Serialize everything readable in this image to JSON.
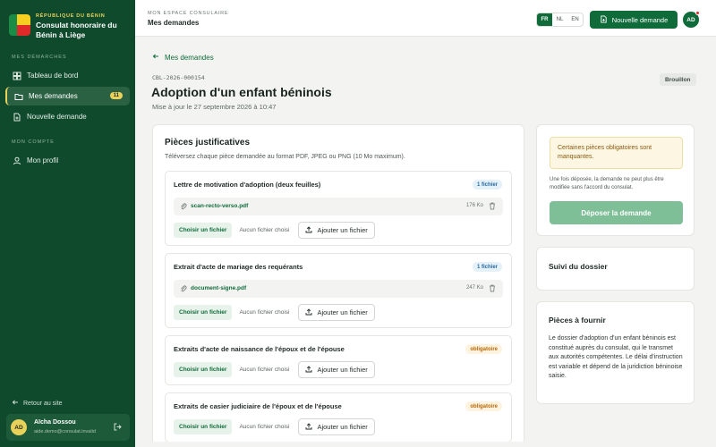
{
  "sidebar": {
    "kicker": "RÉPUBLIQUE DU BÉNIN",
    "org_name": "Consulat honoraire du Bénin à Liège",
    "section_demarches": "MES DÉMARCHES",
    "section_compte": "MON COMPTE",
    "items": [
      {
        "label": "Tableau de bord",
        "icon": "dashboard-icon"
      },
      {
        "label": "Mes demandes",
        "icon": "folder-icon",
        "badge": "11",
        "active": true
      },
      {
        "label": "Nouvelle demande",
        "icon": "file-plus-icon"
      },
      {
        "label": "Mon profil",
        "icon": "user-icon"
      }
    ],
    "back_label": "Retour au site",
    "user": {
      "initials": "AD",
      "name": "Aïcha Dossou",
      "email": "aide.demo@consulat.invalid"
    }
  },
  "header": {
    "kicker": "MON ESPACE CONSULAIRE",
    "title": "Mes demandes",
    "languages": [
      "FR",
      "NL",
      "EN"
    ],
    "active_language": "FR",
    "new_request_label": "Nouvelle demande",
    "avatar_initials": "AD"
  },
  "main": {
    "back_link": "Mes demandes",
    "reference": "CBL-2026-000154",
    "status": "Brouillon",
    "title": "Adoption d'un enfant béninois",
    "updated": "Mise à jour le 27 septembre 2026 à 10:47"
  },
  "pieces": {
    "title": "Pièces justificatives",
    "subtitle": "Téléversez chaque pièce demandée au format PDF, JPEG ou PNG (10 Mo maximum).",
    "choose_label": "Choisir un fichier",
    "no_file_label": "Aucun fichier choisi",
    "add_label": "Ajouter un fichier",
    "items": [
      {
        "title": "Lettre de motivation d'adoption (deux feuilles)",
        "tag": "1 fichier",
        "file": "scan-recto-verso.pdf",
        "size": "176 Ko"
      },
      {
        "title": "Extrait d'acte de mariage des requérants",
        "tag": "1 fichier",
        "file": "document-signe.pdf",
        "size": "247 Ko"
      },
      {
        "title": "Extraits d'acte de naissance de l'époux et de l'épouse",
        "tag": "obligatoire"
      },
      {
        "title": "Extraits de casier judiciaire de l'époux et de l'épouse",
        "tag": "obligatoire"
      }
    ]
  },
  "submit": {
    "warning": "Certaines pièces obligatoires sont manquantes.",
    "note": "Une fois déposée, la demande ne peut plus être modifiée sans l'accord du consulat.",
    "button": "Déposer la demande"
  },
  "suivi": {
    "title": "Suivi du dossier"
  },
  "info": {
    "title": "Pièces à fournir",
    "text": "Le dossier d'adoption d'un enfant béninois est constitué auprès du consulat, qui le transmet aux autorités compétentes. Le délai d'instruction est variable et dépend de la juridiction béninoise saisie."
  },
  "colors": {
    "sidebar": "#0f4a2d",
    "accent": "#0f6b3a",
    "gold": "#e9d25a",
    "flag_red": "#e02a2a"
  }
}
